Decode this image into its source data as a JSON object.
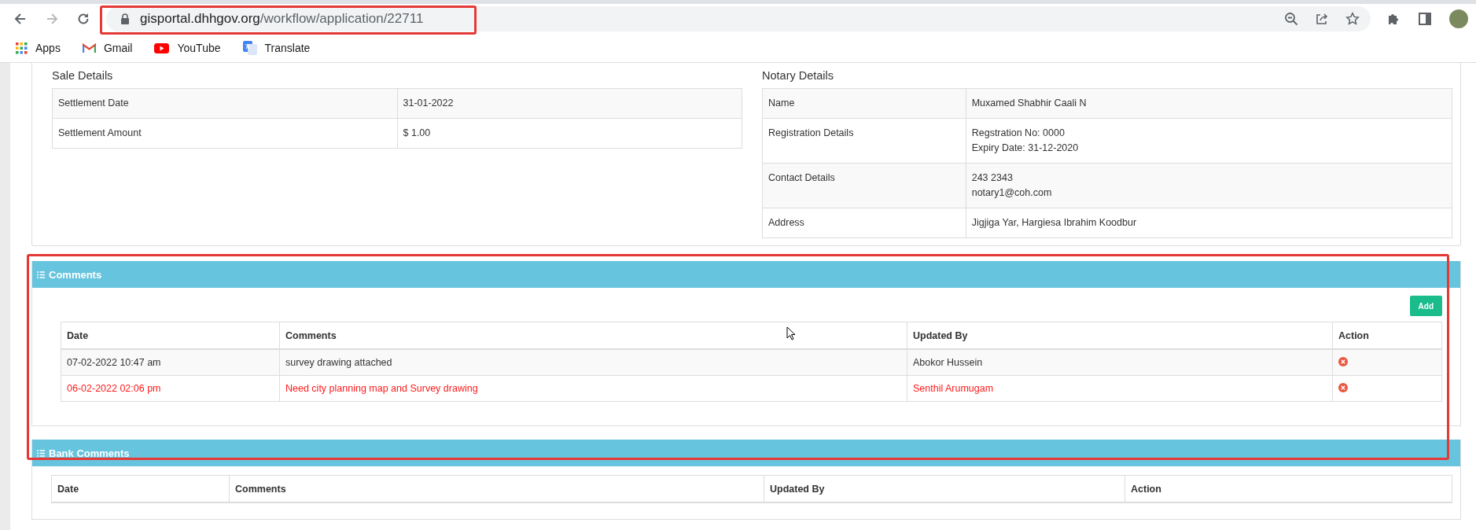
{
  "browser": {
    "url_host": "gisportal.dhhgov.org",
    "url_path": "/workflow/application/22711",
    "bookmarks": [
      {
        "kind": "apps",
        "label": "Apps"
      },
      {
        "kind": "gmail",
        "label": "Gmail"
      },
      {
        "kind": "youtube",
        "label": "YouTube"
      },
      {
        "kind": "translate",
        "label": "Translate"
      }
    ]
  },
  "sale_details": {
    "title": "Sale Details",
    "rows": [
      {
        "label": "Settlement Date",
        "lines": [
          "31-01-2022"
        ]
      },
      {
        "label": "Settlement Amount",
        "lines": [
          "$ 1.00"
        ]
      }
    ]
  },
  "notary_details": {
    "title": "Notary Details",
    "rows": [
      {
        "label": "Name",
        "lines": [
          "Muxamed Shabhir Caali N"
        ]
      },
      {
        "label": "Registration Details",
        "lines": [
          "Regstration No: 0000",
          "Expiry Date: 31-12-2020"
        ]
      },
      {
        "label": "Contact Details",
        "lines": [
          "243 2343",
          "notary1@coh.com"
        ]
      },
      {
        "label": "Address",
        "lines": [
          "Jigjiga Yar, Hargiesa Ibrahim Koodbur"
        ]
      }
    ]
  },
  "comments": {
    "title": "Comments",
    "add_button": "Add",
    "columns": [
      "Date",
      "Comments",
      "Updated By",
      "Action"
    ],
    "rows": [
      {
        "date": "07-02-2022 10:47 am",
        "comment": "survey drawing attached",
        "updated_by": "Abokor Hussein",
        "flagged": false
      },
      {
        "date": "06-02-2022 02:06 pm",
        "comment": "Need city planning map and Survey drawing",
        "updated_by": "Senthil Arumugam",
        "flagged": true
      }
    ]
  },
  "bank_comments": {
    "title": "Bank Comments",
    "columns": [
      "Date",
      "Comments",
      "Updated By",
      "Action"
    ]
  }
}
